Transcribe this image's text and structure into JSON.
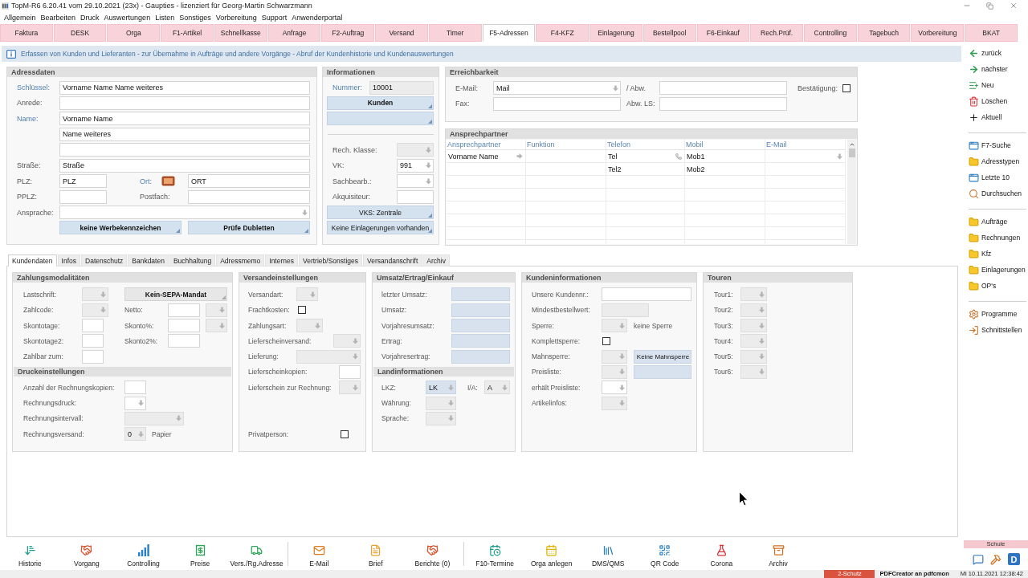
{
  "window": {
    "title": "TopM-R6 6.20.41 vom 29.10.2021 (23x) - Gaupties - lizenziert für Georg-Martin Schwarzmann"
  },
  "menu": [
    "Allgemein",
    "Bearbeiten",
    "Druck",
    "Auswertungen",
    "Listen",
    "Sonstiges",
    "Vorbereitung",
    "Support",
    "Anwenderportal"
  ],
  "module_tabs": [
    {
      "label": "Faktura",
      "selected": false
    },
    {
      "label": "DESK",
      "selected": false
    },
    {
      "label": "Orga",
      "selected": false
    },
    {
      "label": "F1-Artikel",
      "selected": false
    },
    {
      "label": "Schnellkasse",
      "selected": false
    },
    {
      "label": "Anfrage",
      "selected": false
    },
    {
      "label": "F2-Auftrag",
      "selected": false
    },
    {
      "label": "Versand",
      "selected": false
    },
    {
      "label": "Timer",
      "selected": false
    },
    {
      "label": "F5-Adressen",
      "selected": true
    },
    {
      "label": "F4-KFZ",
      "selected": false
    },
    {
      "label": "Einlagerung",
      "selected": false
    },
    {
      "label": "Bestellpool",
      "selected": false
    },
    {
      "label": "F6-Einkauf",
      "selected": false
    },
    {
      "label": "Rech.Prüf.",
      "selected": false
    },
    {
      "label": "Controlling",
      "selected": false
    },
    {
      "label": "Tagebuch",
      "selected": false
    },
    {
      "label": "Vorbereitung",
      "selected": false
    },
    {
      "label": "BKAT",
      "selected": false
    }
  ],
  "info_bar": {
    "text": "Erfassen von Kunden und Lieferanten - zur Übernahme in Aufträge und andere Vorgänge - Abruf der Kundenhistorie und Kundenauswertungen"
  },
  "address": {
    "title": "Adressdaten",
    "rows": [
      {
        "label": "Schlüssel:",
        "highlighted": true,
        "items": [
          {
            "kind": "text",
            "value": "Vorname Name Name weiteres",
            "disabled": false
          }
        ]
      },
      {
        "label": "Anrede:",
        "highlighted": false,
        "items": [
          {
            "kind": "text",
            "disabled": false
          }
        ]
      },
      {
        "label": "Name:",
        "highlighted": true,
        "items": [
          {
            "kind": "text",
            "value": "Vorname Name",
            "disabled": false
          }
        ]
      },
      {
        "items": [
          {
            "kind": "text",
            "value": "Name weiteres",
            "disabled": false
          }
        ]
      },
      {
        "items": [
          {
            "kind": "text",
            "disabled": false
          }
        ]
      },
      {
        "label": "Straße:",
        "highlighted": false,
        "items": [
          {
            "kind": "text",
            "value": "Straße",
            "disabled": false
          }
        ]
      },
      {
        "label": "PLZ:",
        "highlighted": false,
        "items": [
          {
            "kind": "text",
            "value": "PLZ",
            "disabled": false
          },
          {
            "kind": "label",
            "text": "Ort:",
            "highlighted": true
          },
          {
            "kind": "picker"
          },
          {
            "kind": "text",
            "value": "ORT",
            "disabled": false
          }
        ]
      },
      {
        "label": "PPLZ:",
        "highlighted": false,
        "items": [
          {
            "kind": "text",
            "disabled": false
          },
          {
            "kind": "label",
            "text": "Postfach:",
            "highlighted": false
          },
          {
            "kind": "text",
            "disabled": false
          }
        ]
      },
      {
        "label": "Ansprache:",
        "highlighted": false,
        "items": [
          {
            "kind": "select",
            "disabled": false
          }
        ]
      },
      {
        "items": [
          {
            "kind": "button",
            "label": "keine Werbekennzeichen",
            "disabled": false,
            "emphasized": true
          },
          {
            "kind": "button",
            "label": "Prüfe Dubletten",
            "disabled": false,
            "emphasized": true
          }
        ]
      }
    ]
  },
  "information": {
    "title": "Informationen",
    "rows": [
      {
        "label": "Nummer:",
        "highlighted": true,
        "items": [
          {
            "kind": "text",
            "value": "10001",
            "disabled": true
          }
        ]
      },
      {
        "items": [
          {
            "kind": "button",
            "label": "Kunden",
            "disabled": false,
            "emphasized": true
          }
        ]
      },
      {
        "items": [
          {
            "kind": "button",
            "disabled": false
          }
        ]
      },
      {
        "label": "Rech. Klasse:",
        "highlighted": false,
        "items": [
          {
            "kind": "select",
            "disabled": true
          }
        ]
      },
      {
        "label": "VK:",
        "highlighted": false,
        "items": [
          {
            "kind": "select",
            "value": "991",
            "disabled": false
          }
        ]
      },
      {
        "label": "Sachbearb.:",
        "highlighted": false,
        "items": [
          {
            "kind": "select",
            "disabled": false
          }
        ]
      },
      {
        "label": "Akquisiteur:",
        "highlighted": false,
        "items": [
          {
            "kind": "text",
            "disabled": false
          }
        ]
      },
      {
        "items": [
          {
            "kind": "button",
            "label": "VKS: Zentrale",
            "disabled": false,
            "emphasized": false
          }
        ]
      },
      {
        "items": [
          {
            "kind": "button",
            "label": "Keine Einlagerungen vorhanden",
            "disabled": false,
            "emphasized": false
          }
        ]
      }
    ]
  },
  "reachability": {
    "title": "Erreichbarkeit",
    "rows": [
      {
        "label": "E-Mail:",
        "highlighted": false,
        "items": [
          {
            "kind": "select",
            "value": "Mail",
            "disabled": false
          },
          {
            "kind": "label",
            "text": "/ Abw.",
            "highlighted": false
          },
          {
            "kind": "text",
            "disabled": false
          },
          {
            "kind": "label",
            "text": "Bestätigung:",
            "highlighted": false
          },
          {
            "kind": "checkbox",
            "checked": false
          }
        ]
      },
      {
        "label": "Fax:",
        "highlighted": false,
        "items": [
          {
            "kind": "text",
            "disabled": false
          },
          {
            "kind": "label",
            "text": "Abw. LS:",
            "highlighted": false
          },
          {
            "kind": "text",
            "disabled": false
          }
        ]
      }
    ]
  },
  "contacts": {
    "title": "Ansprechpartner",
    "columns": [
      "Ansprechpartner",
      "Funktion",
      "Telefon",
      "Mobil",
      "E-Mail"
    ],
    "rows": [
      {
        "current": true,
        "cells": [
          "Vorname Name",
          null,
          "Tel",
          "Mob1",
          null
        ]
      },
      {
        "current": false,
        "cells": [
          null,
          null,
          "Tel2",
          "Mob2",
          null
        ]
      }
    ]
  },
  "detail_tabs": [
    {
      "label": "Kundendaten",
      "selected": true
    },
    {
      "label": "Infos",
      "selected": false
    },
    {
      "label": "Datenschutz",
      "selected": false
    },
    {
      "label": "Bankdaten",
      "selected": false
    },
    {
      "label": "Buchhaltung",
      "selected": false
    },
    {
      "label": "Adressmemo",
      "selected": false
    },
    {
      "label": "Internes",
      "selected": false
    },
    {
      "label": "Vertrieb/Sonstiges",
      "selected": false
    },
    {
      "label": "Versandanschrift",
      "selected": false
    },
    {
      "label": "Archiv",
      "selected": false
    }
  ],
  "customer_panels": [
    {
      "title": "Zahlungsmodalitäten",
      "rows": [
        {
          "label": "Lastschrift:",
          "highlighted": false,
          "items": [
            {
              "kind": "select",
              "disabled": true
            },
            {
              "kind": "button",
              "label": "Kein-SEPA-Mandat",
              "disabled": true,
              "emphasized": true
            }
          ]
        },
        {
          "label": "Zahlcode:",
          "highlighted": false,
          "items": [
            {
              "kind": "select",
              "disabled": true
            },
            {
              "kind": "label",
              "text": "Netto:",
              "highlighted": false
            },
            {
              "kind": "text",
              "disabled": false
            },
            {
              "kind": "select",
              "disabled": true
            }
          ]
        },
        {
          "label": "Skontotage:",
          "highlighted": false,
          "items": [
            {
              "kind": "text",
              "disabled": false
            },
            {
              "kind": "label",
              "text": "Skonto%:",
              "highlighted": false
            },
            {
              "kind": "text",
              "disabled": false
            },
            {
              "kind": "select",
              "disabled": true
            }
          ]
        },
        {
          "label": "Skontotage2:",
          "highlighted": false,
          "items": [
            {
              "kind": "text",
              "disabled": false
            },
            {
              "kind": "label",
              "text": "Skonto2%:",
              "highlighted": false
            },
            {
              "kind": "text",
              "disabled": false
            }
          ]
        },
        {
          "label": "Zahlbar zum:",
          "highlighted": false,
          "items": [
            {
              "kind": "text",
              "disabled": false
            }
          ]
        }
      ],
      "subsection": {
        "title": "Druckeinstellungen",
        "rows": [
          {
            "label": "Anzahl der Rechnungskopien:",
            "highlighted": false,
            "items": [
              {
                "kind": "text",
                "disabled": false
              }
            ]
          },
          {
            "label": "Rechnungsdruck:",
            "highlighted": false,
            "items": [
              {
                "kind": "select",
                "disabled": false
              }
            ]
          },
          {
            "label": "Rechnungsintervall:",
            "highlighted": false,
            "items": [
              {
                "kind": "select",
                "disabled": true
              }
            ]
          },
          {
            "label": "Rechnungsversand:",
            "highlighted": false,
            "items": [
              {
                "kind": "select",
                "value": "0",
                "disabled": true
              },
              {
                "kind": "note",
                "text": "Papier"
              }
            ]
          }
        ]
      }
    },
    {
      "title": "Versandeinstellungen",
      "rows": [
        {
          "label": "Versandart:",
          "highlighted": false,
          "items": [
            {
              "kind": "select",
              "disabled": true
            }
          ]
        },
        {
          "label": "Frachtkosten:",
          "highlighted": false,
          "items": [
            {
              "kind": "checkbox",
              "checked": false
            }
          ]
        },
        {
          "label": "Zahlungsart:",
          "highlighted": false,
          "items": [
            {
              "kind": "select",
              "disabled": true
            }
          ]
        },
        {
          "label": "Lieferscheinversand:",
          "highlighted": false,
          "items": [
            {
              "kind": "select",
              "disabled": true
            }
          ]
        },
        {
          "label": "Lieferung:",
          "highlighted": false,
          "items": [
            {
              "kind": "select",
              "disabled": true
            }
          ]
        },
        {
          "label": "Lieferscheinkopien:",
          "highlighted": false,
          "items": [
            {
              "kind": "text",
              "disabled": false
            }
          ]
        },
        {
          "label": "Lieferschein zur Rechnung:",
          "highlighted": false,
          "items": [
            {
              "kind": "select",
              "disabled": true
            }
          ]
        },
        {
          "label": "Privatperson:",
          "highlighted": false,
          "items": [
            {
              "kind": "checkbox",
              "checked": false
            }
          ]
        }
      ]
    },
    {
      "title": "Umsatz/Ertrag/Einkauf",
      "rows": [
        {
          "label": "letzter Umsatz:",
          "highlighted": false,
          "items": [
            {
              "kind": "display"
            }
          ]
        },
        {
          "label": "Umsatz:",
          "highlighted": false,
          "items": [
            {
              "kind": "display"
            }
          ]
        },
        {
          "label": "Vorjahresumsatz:",
          "highlighted": false,
          "items": [
            {
              "kind": "display"
            }
          ]
        },
        {
          "label": "Ertrag:",
          "highlighted": false,
          "items": [
            {
              "kind": "display"
            }
          ]
        },
        {
          "label": "Vorjahresertrag:",
          "highlighted": false,
          "items": [
            {
              "kind": "display"
            }
          ]
        }
      ],
      "subsection": {
        "title": "Landinformationen",
        "rows": [
          {
            "label": "LKZ:",
            "highlighted": false,
            "items": [
              {
                "kind": "lookup",
                "value": "LK"
              },
              {
                "kind": "label",
                "text": "I/A:",
                "highlighted": false
              },
              {
                "kind": "select",
                "value": "A",
                "disabled": true
              }
            ]
          },
          {
            "label": "Währung:",
            "highlighted": false,
            "items": [
              {
                "kind": "select",
                "disabled": true
              }
            ]
          },
          {
            "label": "Sprache:",
            "highlighted": false,
            "items": [
              {
                "kind": "select",
                "disabled": true
              }
            ]
          }
        ]
      }
    },
    {
      "title": "Kundeninformationen",
      "rows": [
        {
          "label": "Unsere Kundennr.:",
          "highlighted": false,
          "items": [
            {
              "kind": "text",
              "disabled": false
            }
          ]
        },
        {
          "label": "Mindestbestellwert:",
          "highlighted": false,
          "items": [
            {
              "kind": "text",
              "disabled": true
            }
          ]
        },
        {
          "label": "Sperre:",
          "highlighted": false,
          "items": [
            {
              "kind": "select",
              "disabled": true
            },
            {
              "kind": "note",
              "text": "keine Sperre"
            }
          ]
        },
        {
          "label": "Komplettsperre:",
          "highlighted": false,
          "items": [
            {
              "kind": "checkbox",
              "checked": false
            }
          ]
        },
        {
          "label": "Mahnsperre:",
          "highlighted": false,
          "items": [
            {
              "kind": "select",
              "disabled": true
            },
            {
              "kind": "display",
              "value": "Keine Mahnsperre"
            }
          ]
        },
        {
          "label": "Preisliste:",
          "highlighted": false,
          "items": [
            {
              "kind": "select",
              "disabled": true
            },
            {
              "kind": "display"
            }
          ]
        },
        {
          "label": "erhält Preisliste:",
          "highlighted": false,
          "items": [
            {
              "kind": "select",
              "disabled": false
            }
          ]
        },
        {
          "label": "Artikelinfos:",
          "highlighted": false,
          "items": [
            {
              "kind": "select",
              "disabled": true
            }
          ]
        }
      ]
    },
    {
      "title": "Touren",
      "rows": [
        {
          "label": "Tour1:",
          "highlighted": false,
          "items": [
            {
              "kind": "select",
              "disabled": true
            }
          ]
        },
        {
          "label": "Tour2:",
          "highlighted": false,
          "items": [
            {
              "kind": "select",
              "disabled": true
            }
          ]
        },
        {
          "label": "Tour3:",
          "highlighted": false,
          "items": [
            {
              "kind": "select",
              "disabled": true
            }
          ]
        },
        {
          "label": "Tour4:",
          "highlighted": false,
          "items": [
            {
              "kind": "select",
              "disabled": true
            }
          ]
        },
        {
          "label": "Tour5:",
          "highlighted": false,
          "items": [
            {
              "kind": "select",
              "disabled": true
            }
          ]
        },
        {
          "label": "Tour6:",
          "highlighted": false,
          "items": [
            {
              "kind": "select",
              "disabled": true
            }
          ]
        }
      ]
    }
  ],
  "sidebar": {
    "groups": [
      [
        "zurück",
        "nächster",
        "Neu",
        "Löschen",
        "Aktuell"
      ],
      [
        "F7-Suche",
        "Adresstypen",
        "Letzte 10",
        "Durchsuchen"
      ],
      [
        "Aufträge",
        "Rechnungen",
        "Kfz",
        "Einlagerungen",
        "OP's"
      ],
      [
        "Programme",
        "Schnittstellen"
      ]
    ]
  },
  "toolbar": {
    "groups": [
      [
        "Historie",
        "Vorgang",
        "Controlling",
        "Preise",
        "Vers./Rg.Adresse"
      ],
      [
        "E-Mail",
        "Brief",
        "Berichte (0)"
      ],
      [
        "F10-Termine",
        "Orga anlegen",
        "DMS/QMS",
        "QR Code",
        "Corona",
        "Archiv"
      ]
    ]
  },
  "corner": {
    "label": "Schule",
    "logo_letter": "D"
  },
  "status_bar": {
    "items": [
      {
        "kind": "alert",
        "text": "2-Schutz"
      },
      {
        "kind": "strong",
        "text": "PDFCreator an pdfcmon"
      },
      {
        "kind": "clock",
        "text": "Mi 10.11.2021 12:38:42"
      }
    ]
  }
}
